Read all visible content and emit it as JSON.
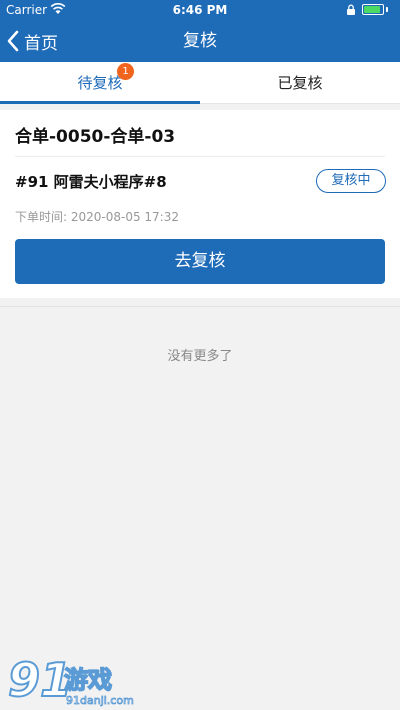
{
  "status_bar": {
    "carrier": "Carrier",
    "time": "6:46 PM",
    "battery_level": 0.9
  },
  "nav": {
    "back_label": "首页",
    "title": "复核"
  },
  "tabs": [
    {
      "label": "待复核",
      "badge": "1",
      "active": true
    },
    {
      "label": "已复核",
      "active": false
    }
  ],
  "order": {
    "title": "合单-0050-合单-03",
    "store": "#91 阿雷夫小程序#8",
    "status": "复核中",
    "time": "下单时间: 2020-08-05 17:32",
    "action_label": "去复核"
  },
  "list_footer": "没有更多了",
  "watermark": {
    "brand": "91游戏",
    "domain": "91danji.com"
  },
  "colors": {
    "primary": "#1e6bb8",
    "badge": "#f0641e",
    "battery": "#4cd964"
  }
}
